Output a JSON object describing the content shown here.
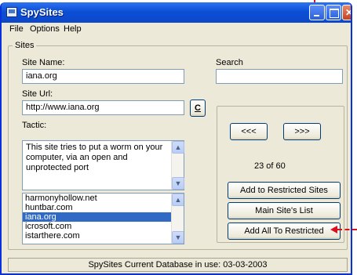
{
  "window": {
    "title": "SpySites"
  },
  "menu": {
    "file": "File",
    "options": "Options",
    "help": "Help"
  },
  "sites_group": {
    "label": "Sites"
  },
  "site_name": {
    "label": "Site Name:",
    "value": "iana.org"
  },
  "site_url": {
    "label": "Site Url:",
    "value": "http://www.iana.org",
    "c_button": "C"
  },
  "search": {
    "label": "Search",
    "value": ""
  },
  "tactic": {
    "label": "Tactic:",
    "text": "This site tries to put a worm on your computer, via an open and unprotected port"
  },
  "site_list": {
    "items": [
      "harmonyhollow.net",
      "huntbar.com",
      "iana.org",
      "icrosoft.com",
      "istarthere.com"
    ],
    "selected_index": 2
  },
  "navigation": {
    "prev_label": "<<<",
    "next_label": ">>>",
    "position_text": "23 of 60"
  },
  "actions": {
    "add_restricted": "Add to Restricted Sites",
    "main_list": "Main Site's List",
    "add_all_restricted": "Add All To Restricted"
  },
  "status_bar": {
    "text": "SpySites Current Database in use:  03-03-2003"
  },
  "annotation_color": "#d9111c",
  "icons": {
    "app": "window-app-icon",
    "minimize": "minimize-icon",
    "maximize": "maximize-icon",
    "close": "close-icon",
    "scroll_up": "scroll-up-arrow-icon",
    "scroll_down": "scroll-down-arrow-icon"
  }
}
